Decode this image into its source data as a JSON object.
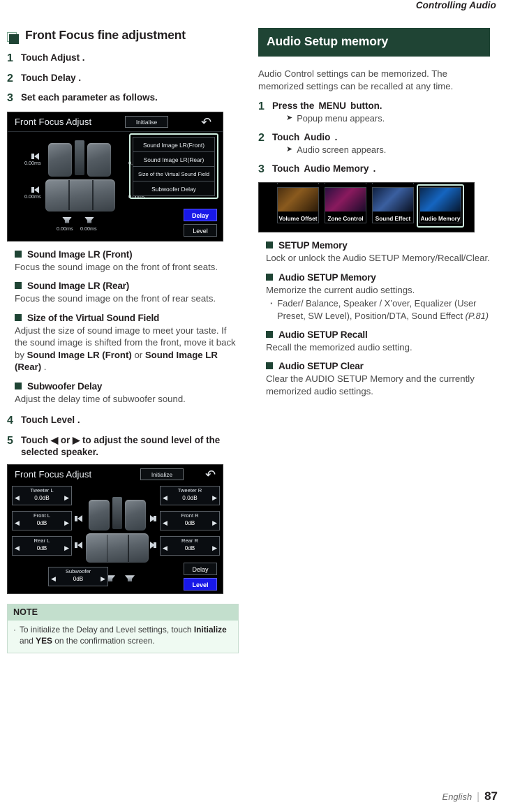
{
  "running_head": "Controlling Audio",
  "footer": {
    "language": "English",
    "separator": "|",
    "page_number": "87"
  },
  "left_column": {
    "heading": "Front Focus fine adjustment",
    "steps": [
      {
        "num": "1",
        "text": "Touch  Adjust ."
      },
      {
        "num": "2",
        "text": "Touch  Delay ."
      },
      {
        "num": "3",
        "text": "Set each parameter as follows."
      }
    ],
    "screenshot_delay": {
      "title": "Front Focus Adjust",
      "initialize_button": "Initialise",
      "back_icon": "back-arrow-icon",
      "menu_items": [
        "Sound Image LR(Front)",
        "Sound Image LR(Rear)",
        "Size of the Virtual Sound Field",
        "Subwoofer Delay"
      ],
      "delay_values": [
        "0.00ms",
        "0.00ms",
        "0.00ms",
        "0.00ms"
      ],
      "subwoofer_values": [
        "0.00ms",
        "0.00ms"
      ],
      "tab_delay": "Delay",
      "tab_level": "Level",
      "active_tab": "Delay"
    },
    "subsections": [
      {
        "label": "Sound Image LR (Front)",
        "body": "Focus the sound image on the front of front seats."
      },
      {
        "label": "Sound Image LR (Rear)",
        "body": "Focus the sound image on the front of rear seats."
      },
      {
        "label": "Size of the Virtual Sound Field",
        "body_part1": "Adjust the size of sound image to meet your taste. If the sound image is shifted from the front, move it back by ",
        "body_bold1": "Sound Image LR (Front)",
        "body_mid": " or ",
        "body_bold2": "Sound Image LR (Rear)",
        "body_end": " ."
      },
      {
        "label": "Subwoofer Delay",
        "body": "Adjust the delay time of subwoofer sound."
      }
    ],
    "steps_tail": [
      {
        "num": "4",
        "text": "Touch  Level ."
      },
      {
        "num": "5",
        "text": "Touch  ◀ or ▶ to adjust the sound level of the selected speaker."
      }
    ],
    "screenshot_level": {
      "title": "Front Focus Adjust",
      "initialize_button": "Initialize",
      "back_icon": "back-arrow-icon",
      "cells": [
        {
          "name": "Tweeter L",
          "value": "0.0dB"
        },
        {
          "name": "Front L",
          "value": "0dB"
        },
        {
          "name": "Rear L",
          "value": "0dB"
        },
        {
          "name": "Tweeter R",
          "value": "0.0dB"
        },
        {
          "name": "Front R",
          "value": "0dB"
        },
        {
          "name": "Rear R",
          "value": "0dB"
        },
        {
          "name": "Subwoofer",
          "value": "0dB"
        }
      ],
      "tab_delay": "Delay",
      "tab_level": "Level",
      "active_tab": "Level"
    },
    "note": {
      "title": "NOTE",
      "text_part1": "To initialize the Delay and Level settings, touch ",
      "bold1": "Initialize",
      "mid": " and ",
      "bold2": "YES",
      "text_end": " on the confirmation screen."
    }
  },
  "right_column": {
    "banner": "Audio Setup memory",
    "intro": "Audio Control settings can be memorized. The memorized settings can be recalled at any time.",
    "steps": [
      {
        "num": "1",
        "text_pre": "Press the ",
        "bold": "MENU",
        "text_post": " button.",
        "sub": "Popup menu appears."
      },
      {
        "num": "2",
        "text_pre": "Touch ",
        "bold": "Audio",
        "text_post": " .",
        "sub": "Audio screen appears."
      },
      {
        "num": "3",
        "text_pre": "Touch ",
        "bold": "Audio Memory",
        "text_post": " .",
        "sub": ""
      }
    ],
    "screenshot_memory": {
      "tiles": [
        "Volume Offset",
        "Zone Control",
        "Sound Effect",
        "Audio Memory"
      ],
      "highlighted_tile": "Audio Memory"
    },
    "subsections": [
      {
        "label": "SETUP Memory",
        "body": "Lock or unlock the Audio SETUP Memory/Recall/Clear."
      },
      {
        "label": "Audio SETUP Memory",
        "body": "Memorize the current audio settings.",
        "bullets": [
          {
            "text": "Fader/ Balance, Speaker / X’over, Equalizer (User Preset, SW Level), Position/DTA, Sound Effect ",
            "ref": "(P.81)"
          }
        ]
      },
      {
        "label": "Audio SETUP Recall",
        "body": "Recall the memorized audio setting."
      },
      {
        "label": "Audio SETUP Clear",
        "body": "Clear the AUDIO SETUP Memory and the currently memorized audio settings."
      }
    ]
  }
}
